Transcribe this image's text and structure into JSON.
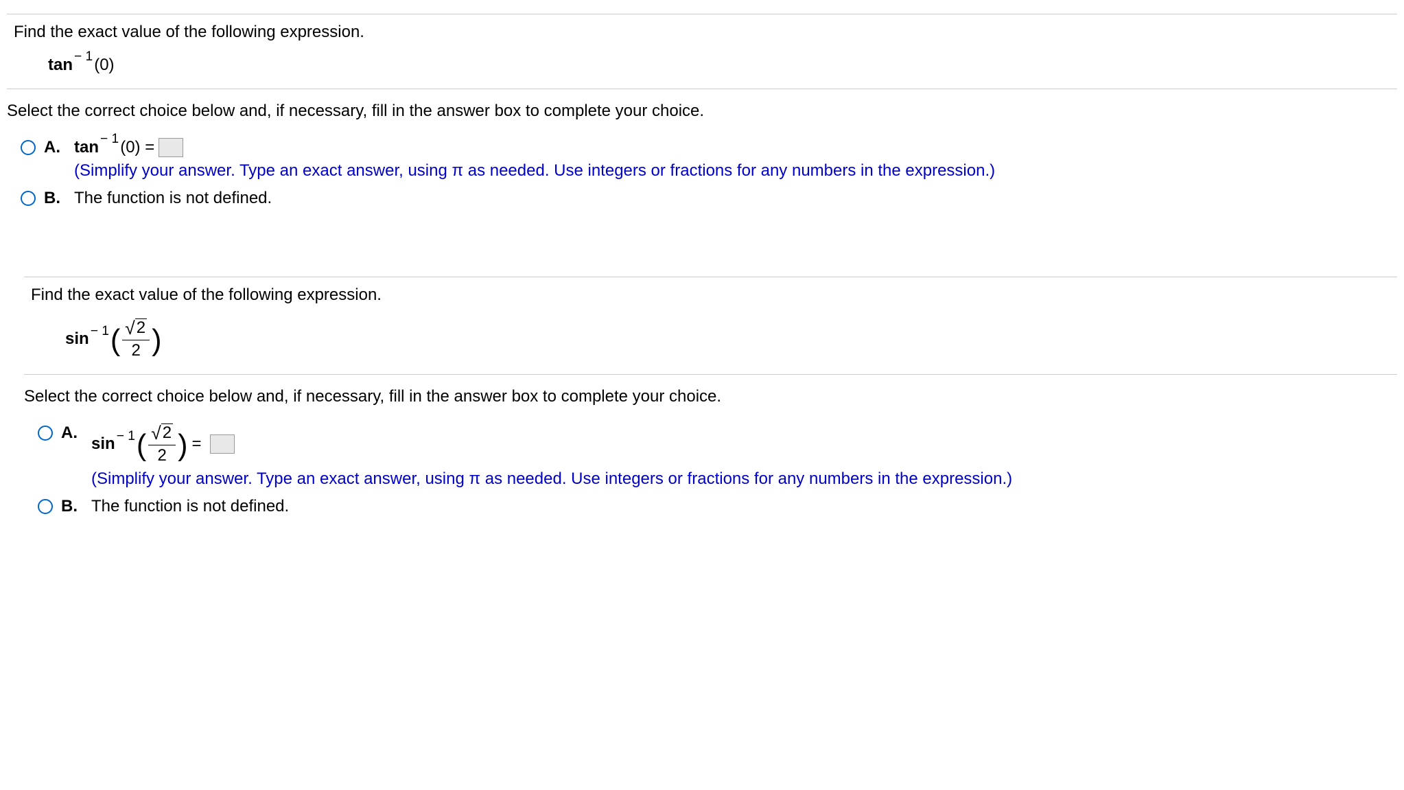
{
  "q1": {
    "prompt": "Find the exact value of the following expression.",
    "fn": "tan",
    "sup": "− 1",
    "arg": "(0)",
    "sub_prompt": "Select the correct choice below and, if necessary, fill in the answer box to complete your choice.",
    "A": {
      "label": "A.",
      "fn": "tan",
      "sup": "− 1",
      "arg": "(0) =",
      "hint": "(Simplify your answer. Type an exact answer, using π as needed. Use integers or fractions for any numbers in the expression.)"
    },
    "B": {
      "label": "B.",
      "text": "The function is not defined."
    }
  },
  "q2": {
    "prompt": "Find the exact value of the following expression.",
    "fn": "sin",
    "sup": "− 1",
    "num_radicand": "2",
    "den": "2",
    "sub_prompt": "Select the correct choice below and, if necessary, fill in the answer box to complete your choice.",
    "A": {
      "label": "A.",
      "fn": "sin",
      "sup": "− 1",
      "num_radicand": "2",
      "den": "2",
      "eq": "=",
      "hint": "(Simplify your answer. Type an exact answer, using π as needed. Use integers or fractions for any numbers in the expression.)"
    },
    "B": {
      "label": "B.",
      "text": "The function is not defined."
    }
  }
}
